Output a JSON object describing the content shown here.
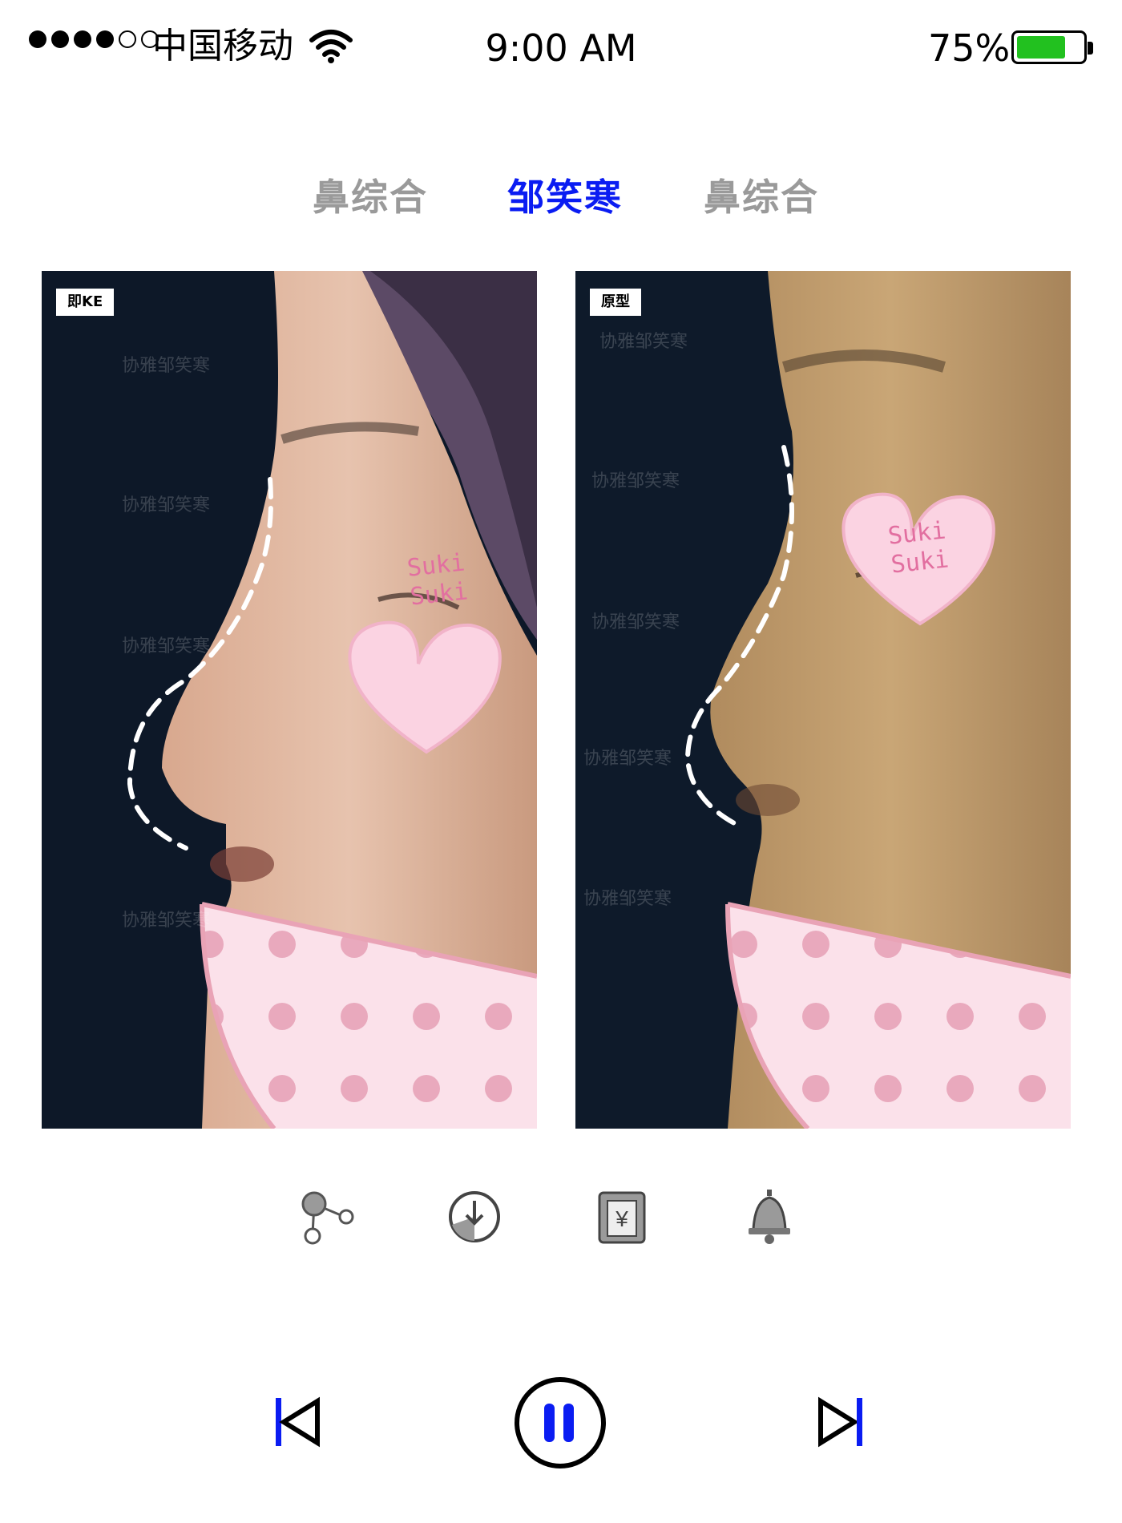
{
  "status_bar": {
    "signal_full": 4,
    "signal_total": 6,
    "carrier": "中国移动",
    "time": "9:00 AM",
    "battery_percent_label": "75%",
    "battery_level": 0.75,
    "battery_color": "#22c11f"
  },
  "tabs": [
    {
      "label": "鼻综合",
      "active": false
    },
    {
      "label": "邹笑寒",
      "active": true
    },
    {
      "label": "鼻综合",
      "active": false
    }
  ],
  "colors": {
    "accent": "#0a1cf2",
    "inactive_tab": "#9a9a9a",
    "tag_bg": "#ffffff"
  },
  "photos": [
    {
      "tag": "即KE",
      "sticker_text": [
        "Suki",
        "Suki"
      ],
      "watermark": "协雅邹笑寒"
    },
    {
      "tag": "原型",
      "sticker_text": [
        "Suki",
        "Suki"
      ],
      "watermark": "协雅邹笑寒"
    }
  ],
  "tools": [
    {
      "icon": "share-nodes-icon"
    },
    {
      "icon": "download-timer-icon"
    },
    {
      "icon": "payment-yen-icon"
    },
    {
      "icon": "bell-icon"
    }
  ],
  "player": {
    "prev_icon": "skip-previous-icon",
    "play_state": "playing",
    "pause_icon": "pause-icon",
    "next_icon": "skip-next-icon"
  }
}
